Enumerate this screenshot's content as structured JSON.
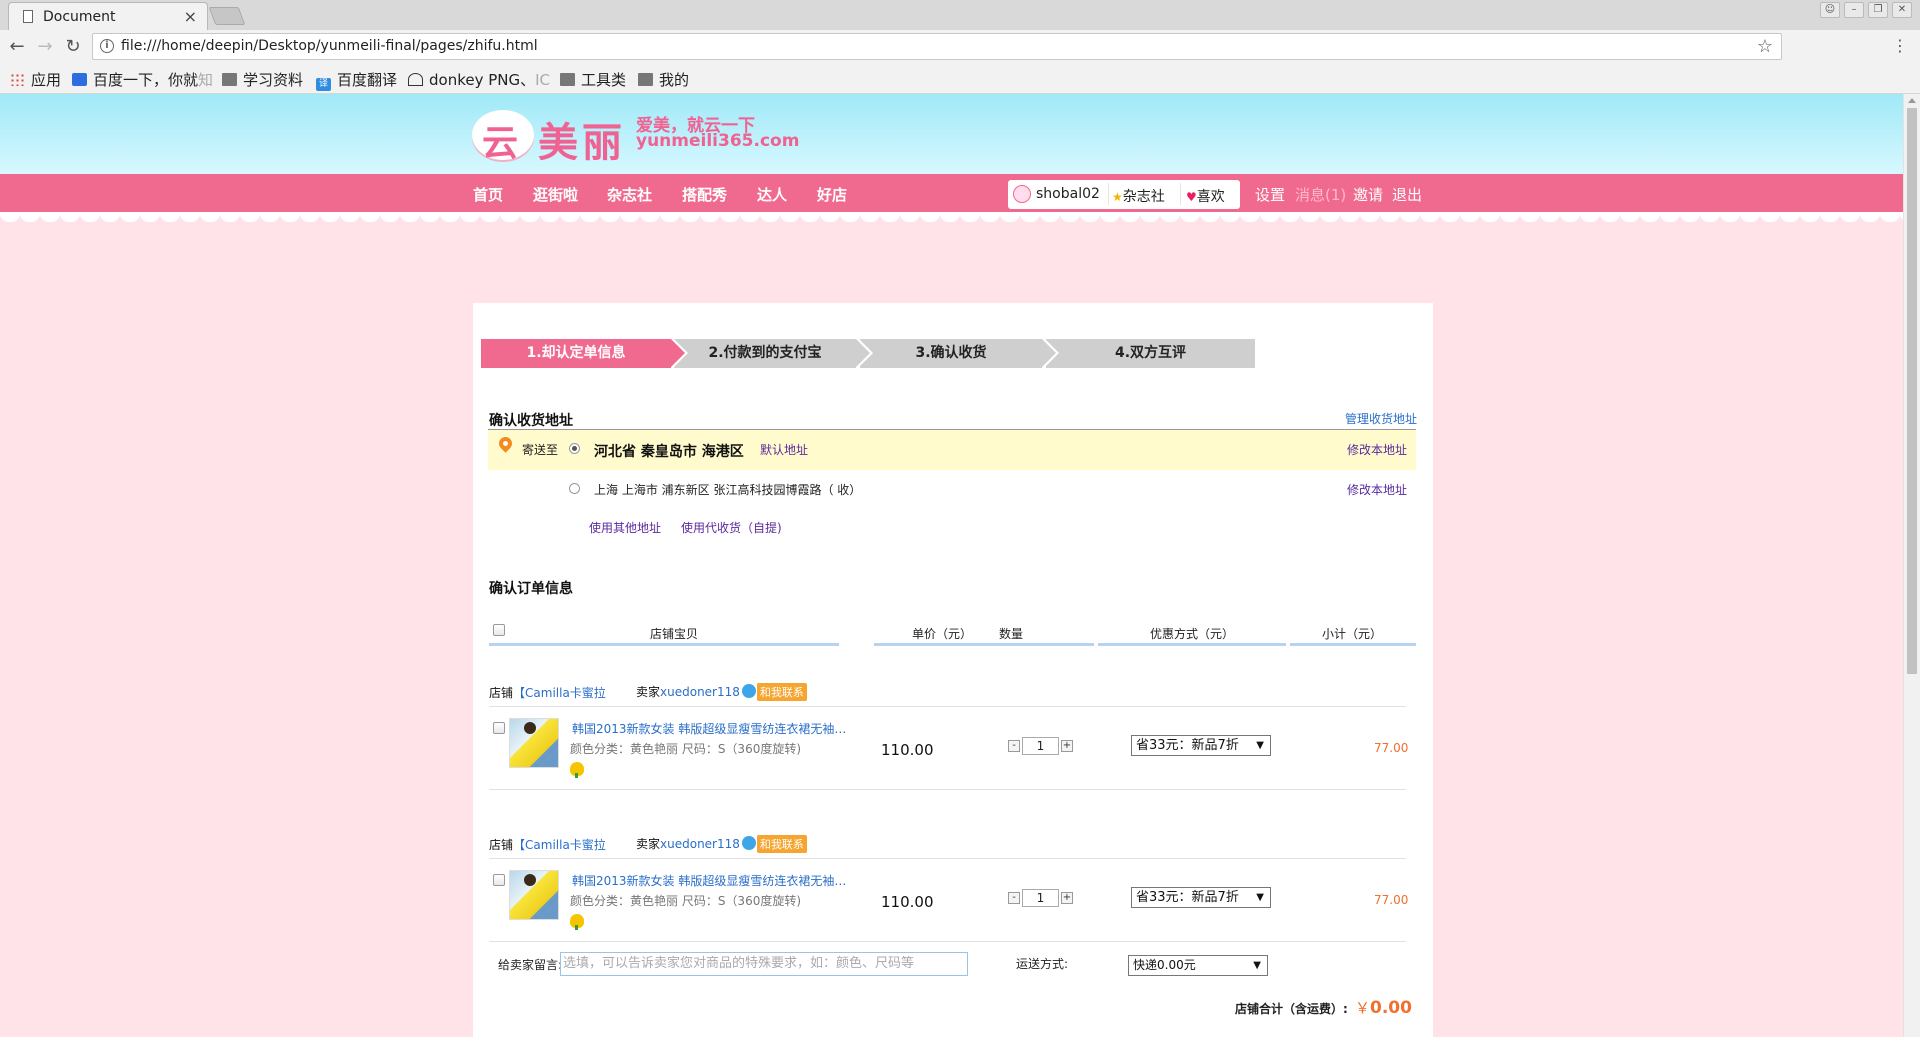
{
  "browser": {
    "tab_title": "Document",
    "tab_close": "×",
    "url": "file:///home/deepin/Desktop/yunmeili-final/pages/zhifu.html",
    "bookmarks": [
      {
        "label": "应用",
        "icon": "apps-icon"
      },
      {
        "label": "百度一下，你就",
        "fade": "知",
        "icon": "baidu-icon"
      },
      {
        "label": "学习资料",
        "icon": "folder-icon"
      },
      {
        "label": "百度翻译",
        "icon": "translate-icon"
      },
      {
        "label": "donkey PNG、",
        "fade": "IC",
        "icon": "donkey-icon"
      },
      {
        "label": "工具类",
        "icon": "folder-icon"
      },
      {
        "label": "我的",
        "icon": "folder-icon"
      }
    ]
  },
  "site": {
    "logo_cloud": "云",
    "logo_name": "美丽",
    "slogan": "爱美，就云一下",
    "domain": "yunmeili365.com",
    "nav": [
      "首页",
      "逛街啦",
      "杂志社",
      "搭配秀",
      "达人",
      "好店"
    ],
    "user": {
      "name": "shobal02",
      "star": "★",
      "magazine": "杂志社",
      "heart": "♥",
      "like": "喜欢"
    },
    "top_links": {
      "settings": "设置",
      "messages": "消息(1)",
      "invite": "邀请",
      "logout": "退出"
    }
  },
  "steps": [
    "1.却认定单信息",
    "2.付款到的支付宝",
    "3.确认收货",
    "4.双方互评"
  ],
  "address": {
    "title": "确认收货地址",
    "manage": "管理收货地址",
    "send_to": "寄送至",
    "primary": "河北省 秦皇岛市 海港区",
    "default_tag": "默认地址",
    "edit": "修改本地址",
    "secondary": "上海 上海市 浦东新区 张江高科技园博霞路（ 收）",
    "use_other": "使用其他地址",
    "use_pickup": "使用代收货（自提)"
  },
  "order": {
    "title": "确认订单信息",
    "headers": [
      "店铺宝贝",
      "单价（元）",
      "数量",
      "优惠方式（元）",
      "小计（元）"
    ],
    "items": [
      {
        "shop_label": "店铺",
        "shop_name": "【Camilla卡蜜拉",
        "seller_label": "卖家",
        "seller_name": "xuedoner118",
        "contact": "和我联系",
        "title": "韩国2013新款女装 韩版超级显瘦雪纺连衣裙无袖…",
        "meta": "颜色分类：黄色艳丽 尺码：S（360度旋转)",
        "price": "110.00",
        "qty": "1",
        "minus": "-",
        "plus": "+",
        "discount": "省33元：新品7折",
        "subtotal": "77.00"
      },
      {
        "shop_label": "店铺",
        "shop_name": "【Camilla卡蜜拉",
        "seller_label": "卖家",
        "seller_name": "xuedoner118",
        "contact": "和我联系",
        "title": "韩国2013新款女装 韩版超级显瘦雪纺连衣裙无袖…",
        "meta": "颜色分类：黄色艳丽 尺码：S（360度旋转)",
        "price": "110.00",
        "qty": "1",
        "minus": "-",
        "plus": "+",
        "discount": "省33元：新品7折",
        "subtotal": "77.00"
      }
    ],
    "message_label": "给卖家留言:",
    "message_placeholder": "选填，可以告诉卖家您对商品的特殊要求，如：颜色、尺码等",
    "shipping_label": "运送方式:",
    "shipping_value": "快递0.00元",
    "total_label": "店铺合计（含运费）:",
    "currency": "￥",
    "total_value": "0.00"
  },
  "colors": {
    "pink": "#f06a8f",
    "page_bg": "#ffe3e8",
    "link": "#2a6fc9",
    "orange": "#f07030"
  }
}
